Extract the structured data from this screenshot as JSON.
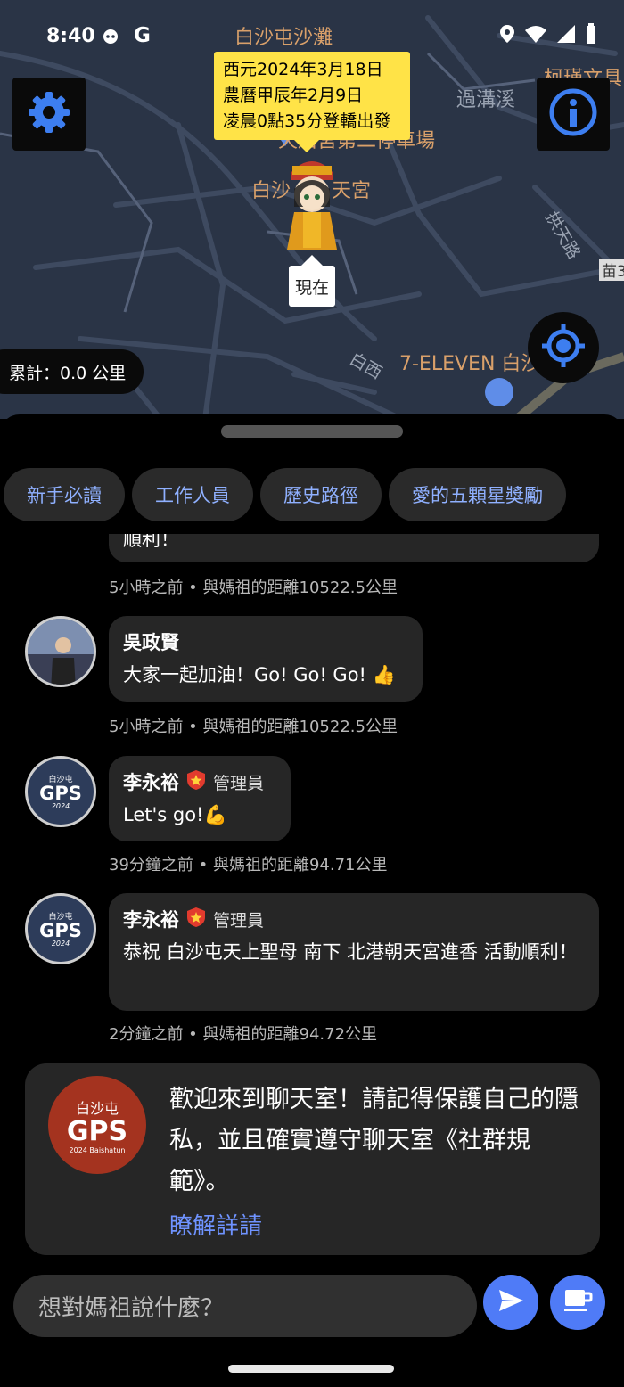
{
  "status_bar": {
    "time": "8:40",
    "g_label": "G"
  },
  "map": {
    "labels": [
      "白沙屯沙灘",
      "柯瑾文具",
      "過溝溪",
      "天后宮第二停車場",
      "白沙",
      "天宮",
      "拱天路",
      "苗3",
      "白西",
      "7-ELEVEN 白沙"
    ],
    "callout": {
      "line1": "西元2024年3月18日",
      "line2": "農曆甲辰年2月9日",
      "line3": "凌晨0點35分登轎出發"
    },
    "now_tag": "現在",
    "distance": "累計：0.0 公里"
  },
  "chips": [
    "新手必讀",
    "工作人員",
    "歷史路徑",
    "愛的五顆星獎勵"
  ],
  "messages": {
    "m0": {
      "text_tail": "順利！",
      "meta": "5小時之前 • 與媽祖的距離10522.5公里"
    },
    "m1": {
      "name": "吳政賢",
      "text": "大家一起加油！Go! Go! Go! 👍",
      "meta": "5小時之前 • 與媽祖的距離10522.5公里"
    },
    "m2": {
      "name": "李永裕",
      "role": "管理員",
      "text": "Let's go!💪",
      "meta": "39分鐘之前 • 與媽祖的距離94.71公里"
    },
    "m3": {
      "name": "李永裕",
      "role": "管理員",
      "text": "恭祝 白沙屯天上聖母 南下 北港朝天宮進香 活動順利！",
      "meta": "2分鐘之前 • 與媽祖的距離94.72公里"
    }
  },
  "gps_avatar": {
    "top": "白沙屯",
    "mid": "GPS",
    "year": "2024"
  },
  "welcome": {
    "logo_top": "白沙屯",
    "logo_mid": "GPS",
    "logo_bottom": "2024 Baishatun",
    "text": "歡迎來到聊天室！請記得保護自己的隱私，並且確實遵守聊天室《社群規範》。",
    "link": "瞭解詳請"
  },
  "composer": {
    "placeholder": "想對媽祖說什麼？"
  },
  "colors": {
    "accent": "#4f7bf7",
    "chip_text": "#8fb0ff",
    "callout": "#ffe347"
  }
}
